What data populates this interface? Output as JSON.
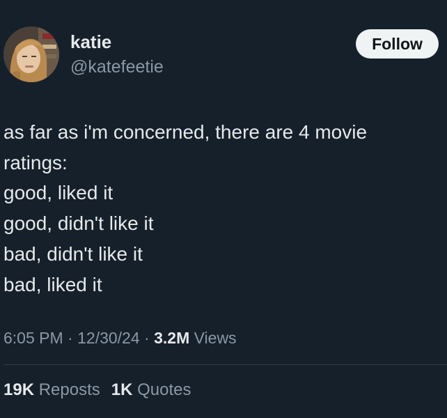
{
  "author": {
    "display_name": "katie",
    "handle": "@katefeetie",
    "avatar_icon": "profile-photo"
  },
  "follow_button": {
    "label": "Follow"
  },
  "tweet": {
    "lines": [
      "as far as i'm concerned, there are 4 movie",
      "ratings:",
      "good, liked it",
      "good, didn't like it",
      "bad, didn't like it",
      "bad, liked it"
    ]
  },
  "meta": {
    "time": "6:05 PM",
    "separator": "·",
    "date": "12/30/24",
    "views_count": "3.2M",
    "views_label": "Views"
  },
  "stats": {
    "reposts_count": "19K",
    "reposts_label": "Reposts",
    "quotes_count": "1K",
    "quotes_label": "Quotes"
  },
  "colors": {
    "background": "#15202b",
    "primary_text": "#e7e9ea",
    "secondary_text": "#8b98a5",
    "follow_button_bg": "#eff3f4",
    "follow_button_text": "#0f1419"
  }
}
